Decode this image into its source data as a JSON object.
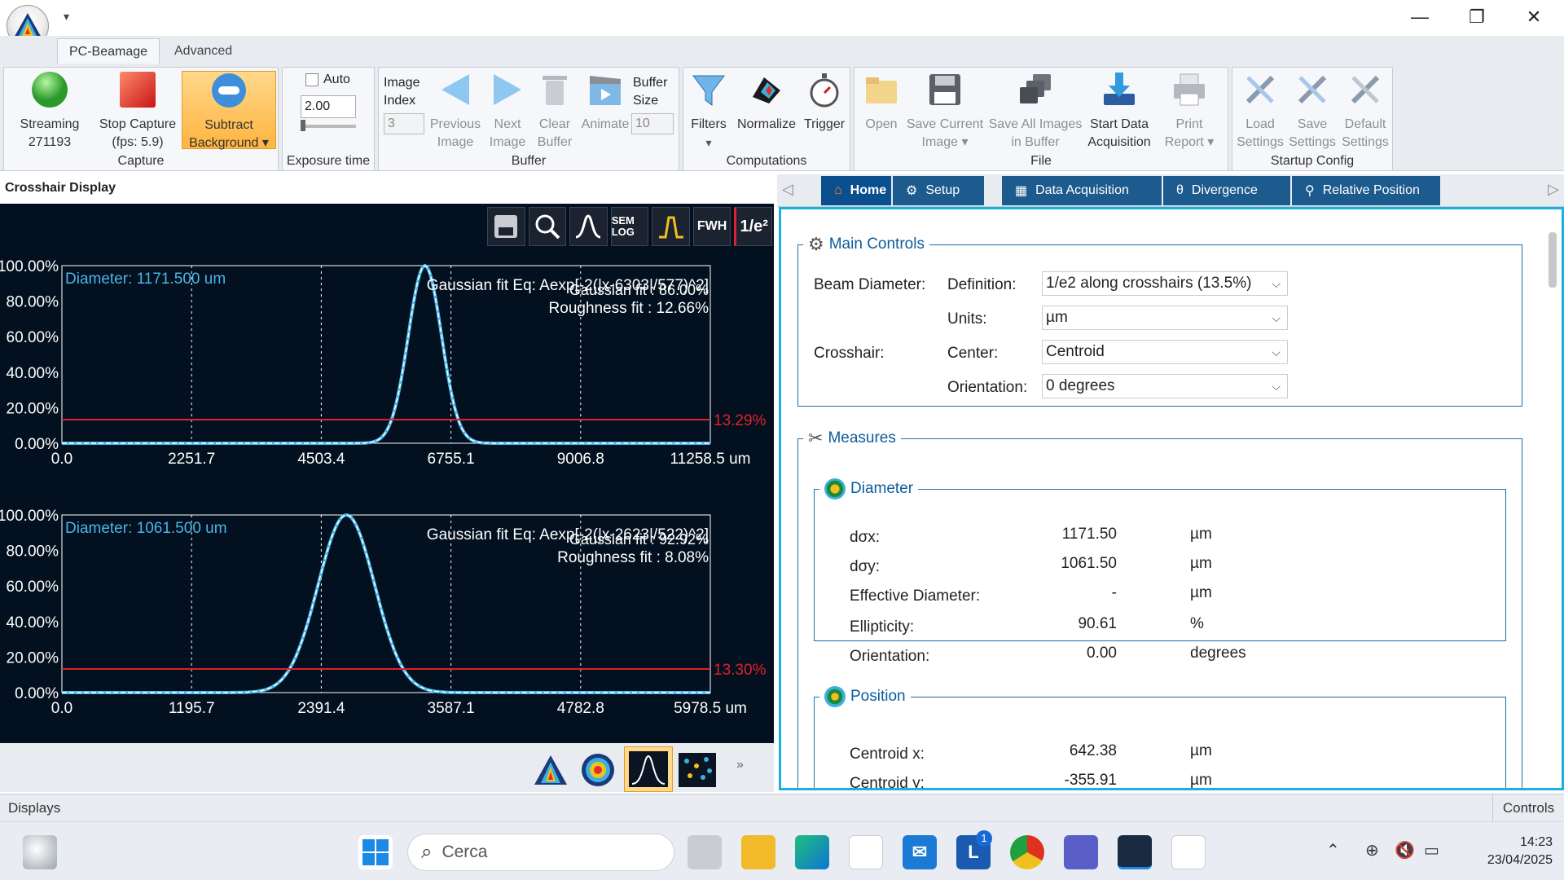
{
  "window": {
    "minimize_glyph": "—",
    "maximize_glyph": "❐",
    "close_glyph": "✕",
    "quick_access_glyph": "▾"
  },
  "ribbon_tabs": [
    "PC-Beamage",
    "Advanced"
  ],
  "capture": {
    "streaming_label": "Streaming",
    "streaming_count": "271193",
    "stop_label": "Stop Capture",
    "fps_label": "(fps: 5.9)",
    "subtract_label1": "Subtract",
    "subtract_label2": "Background",
    "group_label": "Capture"
  },
  "exposure": {
    "auto_label": "Auto",
    "value": "2.00",
    "group_label": "Exposure time"
  },
  "buffer": {
    "image_index_label1": "Image",
    "image_index_label2": "Index",
    "image_index_value": "3",
    "prev1": "Previous",
    "prev2": "Image",
    "next1": "Next",
    "next2": "Image",
    "clear1": "Clear",
    "clear2": "Buffer",
    "animate": "Animate",
    "size1": "Buffer",
    "size2": "Size",
    "size_value": "10",
    "group_label": "Buffer"
  },
  "computations": {
    "filters": "Filters",
    "normalize": "Normalize",
    "trigger": "Trigger",
    "group_label": "Computations"
  },
  "file": {
    "open": "Open",
    "save_current1": "Save Current",
    "save_current2": "Image",
    "save_all1": "Save All Images",
    "save_all2": "in Buffer",
    "start1": "Start Data",
    "start2": "Acquisition",
    "print1": "Print",
    "print2": "Report",
    "group_label": "File"
  },
  "startup": {
    "load1": "Load",
    "load2": "Settings",
    "save1": "Save",
    "save2": "Settings",
    "default1": "Default",
    "default2": "Settings",
    "group_label": "Startup Config"
  },
  "crosshair": {
    "title": "Crosshair Display",
    "toolbar": [
      "",
      "",
      "",
      "SEM LOG",
      "",
      "FWH",
      "1/e²"
    ]
  },
  "colors": {
    "accent": "#1bb0e0",
    "tab": "#1d5a8e",
    "profile": "#48b6e8",
    "threshold": "#e0202a",
    "plot_bg": "#03101f"
  },
  "chart_data": [
    {
      "type": "line",
      "title": "",
      "annotations": [
        "Diameter: 1171.500 um",
        "Gaussian fit Eq: Aexp[-2(|x-6303|/577)^2]",
        "Gaussian fit : 86.00%",
        "Roughness fit : 12.66%"
      ],
      "threshold_label": "13.29%",
      "threshold": 13.29,
      "xlabel": "",
      "ylabel": "",
      "x_ticks": [
        "0.0",
        "2251.7",
        "4503.4",
        "6755.1",
        "9006.8",
        "11258.5 um"
      ],
      "y_ticks": [
        "0.00%",
        "20.00%",
        "40.00%",
        "60.00%",
        "80.00%",
        "100.00%"
      ],
      "xlim": [
        0,
        11258.5
      ],
      "ylim": [
        0,
        100
      ],
      "grid": true,
      "series": [
        {
          "values_gaussian": {
            "center": 6303,
            "width": 577,
            "amplitude": 100
          }
        }
      ]
    },
    {
      "type": "line",
      "title": "",
      "annotations": [
        "Diameter: 1061.500 um",
        "Gaussian fit Eq: Aexp[-2(|x-2623|/522)^2]",
        "Gaussian fit : 92.92%",
        "Roughness fit : 8.08%"
      ],
      "threshold_label": "13.30%",
      "threshold": 13.3,
      "xlabel": "",
      "ylabel": "",
      "x_ticks": [
        "0.0",
        "1195.7",
        "2391.4",
        "3587.1",
        "4782.8",
        "5978.5 um"
      ],
      "y_ticks": [
        "0.00%",
        "20.00%",
        "40.00%",
        "60.00%",
        "80.00%",
        "100.00%"
      ],
      "xlim": [
        0,
        5978.5
      ],
      "ylim": [
        0,
        100
      ],
      "grid": true,
      "series": [
        {
          "values_gaussian": {
            "center": 2623,
            "width": 522,
            "amplitude": 100
          }
        }
      ]
    }
  ],
  "right_tabs": [
    "Home",
    "Setup",
    "Data Acquisition",
    "Divergence",
    "Relative Position"
  ],
  "main_controls": {
    "legend": "Main Controls",
    "beam_diameter": "Beam Diameter:",
    "definition_label": "Definition:",
    "definition_value": "1/e2 along crosshairs (13.5%)",
    "units_label": "Units:",
    "units_value": "µm",
    "crosshair_label": "Crosshair:",
    "center_label": "Center:",
    "center_value": "Centroid",
    "orientation_label": "Orientation:",
    "orientation_value": "0 degrees"
  },
  "measures": {
    "legend": "Measures",
    "diameter": {
      "legend": "Diameter",
      "rows": [
        {
          "label": "dσx:",
          "value": "1171.50",
          "unit": "µm"
        },
        {
          "label": "dσy:",
          "value": "1061.50",
          "unit": "µm"
        },
        {
          "label": "Effective Diameter:",
          "value": "-",
          "unit": "µm"
        },
        {
          "label": "Ellipticity:",
          "value": "90.61",
          "unit": "%"
        },
        {
          "label": "Orientation:",
          "value": "0.00",
          "unit": "degrees"
        }
      ]
    },
    "position": {
      "legend": "Position",
      "rows": [
        {
          "label": "Centroid x:",
          "value": "642.38",
          "unit": "µm"
        },
        {
          "label": "Centroid y:",
          "value": "-355.91",
          "unit": "µm"
        }
      ]
    }
  },
  "status": {
    "left": "Displays",
    "right": "Controls"
  },
  "taskbar": {
    "search_placeholder": "Cerca",
    "time": "14:23",
    "date": "23/04/2025",
    "badge": "1"
  }
}
